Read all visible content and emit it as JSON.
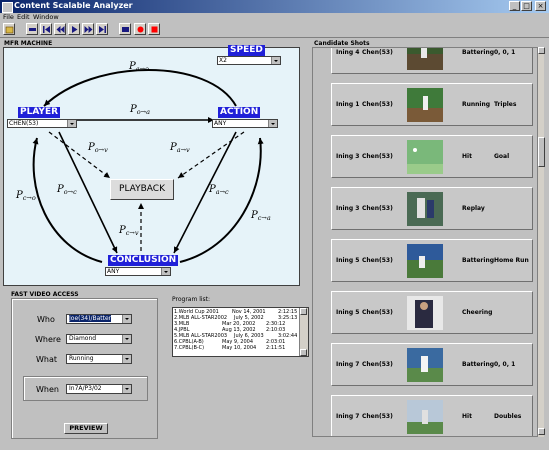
{
  "window": {
    "title": "Content Scalable Analyzer",
    "controls": [
      "_",
      "□",
      "×"
    ]
  },
  "menu": [
    "File",
    "Edit",
    "Window"
  ],
  "toolbar": {
    "buttons": [
      "open-icon",
      "stop-icon",
      "prev-icon",
      "rewind-icon",
      "play-icon",
      "fast-forward-icon",
      "next-icon",
      "capture-icon",
      "record-icon",
      "stop-record-icon"
    ],
    "record_color": "#ff0000"
  },
  "mfr": {
    "label": "MFR MACHINE",
    "speed": {
      "label": "SPEED",
      "value": "X2"
    },
    "player": {
      "label": "PLAYER",
      "value": "CHEN(53)"
    },
    "action": {
      "label": "ACTION",
      "value": "ANY"
    },
    "conclusion": {
      "label": "CONCLUSION",
      "value": "ANY"
    },
    "playback_button": "PLAYBACK",
    "edge_labels": {
      "p_a_o": "P",
      "p_a_o_sub": "a→o",
      "p_o_a": "P",
      "p_o_a_sub": "o→a",
      "p_o_v": "P",
      "p_o_v_sub": "o→v",
      "p_a_v": "P",
      "p_a_v_sub": "a→v",
      "p_o_c": "P",
      "p_o_c_sub": "o→c",
      "p_a_c": "P",
      "p_a_c_sub": "a→c",
      "p_c_o": "P",
      "p_c_o_sub": "c→o",
      "p_c_a": "P",
      "p_c_a_sub": "c→a",
      "p_c_v": "P",
      "p_c_v_sub": "c→v"
    },
    "node_color": "#2020d8",
    "background": "#e6f3f9"
  },
  "fast_access": {
    "label": "FAST VIDEO ACCESS",
    "who_label": "Who",
    "who_value": "Joe(34)/Batter",
    "where_label": "Where",
    "where_value": "Diamond",
    "what_label": "What",
    "what_value": "Running",
    "when_label": "When",
    "when_value": "In7A/P3/02",
    "preview_button": "PREVIEW"
  },
  "program_list": {
    "label": "Program list:",
    "rows": [
      {
        "name": "1.World Cup 2001",
        "date": "Nov 14, 2001",
        "time": "2:12:15"
      },
      {
        "name": "2.MLB ALL-STAR2002",
        "date": "July 5, 2002",
        "time": "3:25:13"
      },
      {
        "name": "3.MLB",
        "date": "Mar 20, 2002",
        "time": "2:30:12"
      },
      {
        "name": "4.JPBL",
        "date": "Aug 13, 2002",
        "time": "2:10:03"
      },
      {
        "name": "5.MLB ALL-STAR2003",
        "date": "July 6, 2003",
        "time": "3:02:44"
      },
      {
        "name": "6.CPBL(A-B)",
        "date": "May 9, 2004",
        "time": "2:03:01"
      },
      {
        "name": "7.CPBL(B-C)",
        "date": "May 10, 2004",
        "time": "2:11:51"
      }
    ]
  },
  "candidates": {
    "label": "Candidate Shots",
    "shots": [
      {
        "inning": "Ining 4",
        "player": "Chen(53)",
        "action": "Battering",
        "result": "0, 0, 1"
      },
      {
        "inning": "Ining 1",
        "player": "Chen(53)",
        "action": "Running",
        "result": "Triples"
      },
      {
        "inning": "Ining 3",
        "player": "Chen(53)",
        "action": "Hit",
        "result": "Goal"
      },
      {
        "inning": "Ining 3",
        "player": "Chen(53)",
        "action": "Replay",
        "result": ""
      },
      {
        "inning": "Ining 5",
        "player": "Chen(53)",
        "action": "Battering",
        "result": "Home Run"
      },
      {
        "inning": "Ining 5",
        "player": "Chen(53)",
        "action": "Cheering",
        "result": ""
      },
      {
        "inning": "Ining 7",
        "player": "Chen(53)",
        "action": "Battering",
        "result": "0, 0, 1"
      },
      {
        "inning": "Ining 7",
        "player": "Chen(53)",
        "action": "Hit",
        "result": "Doubles"
      }
    ]
  }
}
